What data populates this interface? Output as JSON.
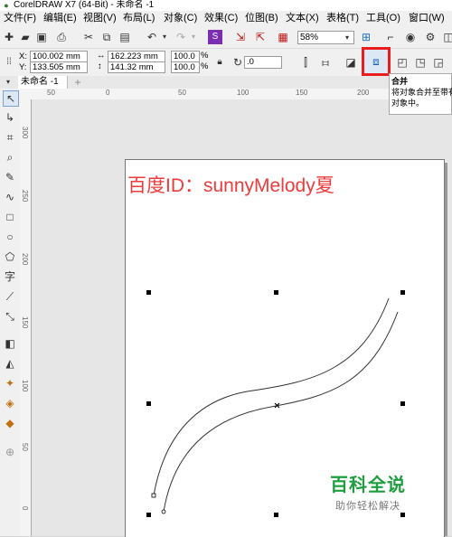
{
  "window": {
    "title": "CorelDRAW X7 (64-Bit) - 未命名 -1"
  },
  "menu": [
    "文件(F)",
    "编辑(E)",
    "视图(V)",
    "布局(L)",
    "对象(C)",
    "效果(C)",
    "位图(B)",
    "文本(X)",
    "表格(T)",
    "工具(O)",
    "窗口(W)"
  ],
  "toolbar": {
    "zoom": "58%"
  },
  "props": {
    "x_label": "X:",
    "x": "100.002 mm",
    "y_label": "Y:",
    "y": "133.505 mm",
    "w": "162.223 mm",
    "h": "141.32 mm",
    "sx": "100.0",
    "sy": "100.0",
    "pct": "%",
    "angle": ".0"
  },
  "tab": {
    "name": "未命名 -1",
    "add": "+"
  },
  "ruler": {
    "h": [
      "50",
      "0",
      "50",
      "100",
      "150",
      "200",
      "250"
    ],
    "v": [
      "300",
      "250",
      "200",
      "150",
      "100",
      "50",
      "0"
    ]
  },
  "tooltip": {
    "title": "合并",
    "line1": "将对象合并至带有",
    "line2": "对象中。"
  },
  "canvas": {
    "watermark": "百度ID：sunnyMelody夏"
  },
  "brand": {
    "name": "百科全说",
    "slogan": "助你轻松解决"
  },
  "colors": {
    "watermark": "#ee3b3b",
    "highlight": "#e81d1d",
    "brand": "#1f9e3f"
  }
}
